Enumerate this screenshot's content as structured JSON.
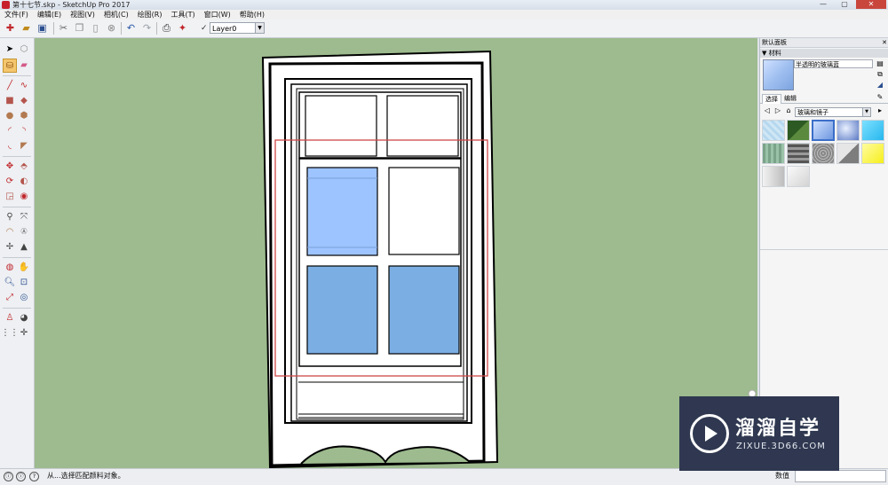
{
  "window": {
    "title": "第十七节.skp - SketchUp Pro 2017",
    "buttons": [
      "—",
      "▢",
      "✕"
    ]
  },
  "menu": [
    "文件(F)",
    "编辑(E)",
    "视图(V)",
    "相机(C)",
    "绘图(R)",
    "工具(T)",
    "窗口(W)",
    "帮助(H)"
  ],
  "toolbar": {
    "layer_value": "Layer0",
    "layer_check": "✓"
  },
  "tray": {
    "title": "默认面板",
    "close": "✕",
    "panel": "▼ 材料",
    "material_name": "半透明的玻璃蓝",
    "tabs": [
      "选择",
      "编辑"
    ],
    "library": "玻璃和镜子",
    "colors": {
      "preview": "#9fbff0"
    }
  },
  "status": {
    "message": "从...选择匹配颜料对象。",
    "measure_label": "数值"
  },
  "watermark": {
    "title": "溜溜自学",
    "subtitle": "ZIXUE.3D66.COM"
  },
  "scene": {
    "selected_glass_color": "#9ec4ff",
    "glass_color": "#7baee3",
    "background_color": "#9dbb8e",
    "selection_box_color": "#d04848"
  }
}
